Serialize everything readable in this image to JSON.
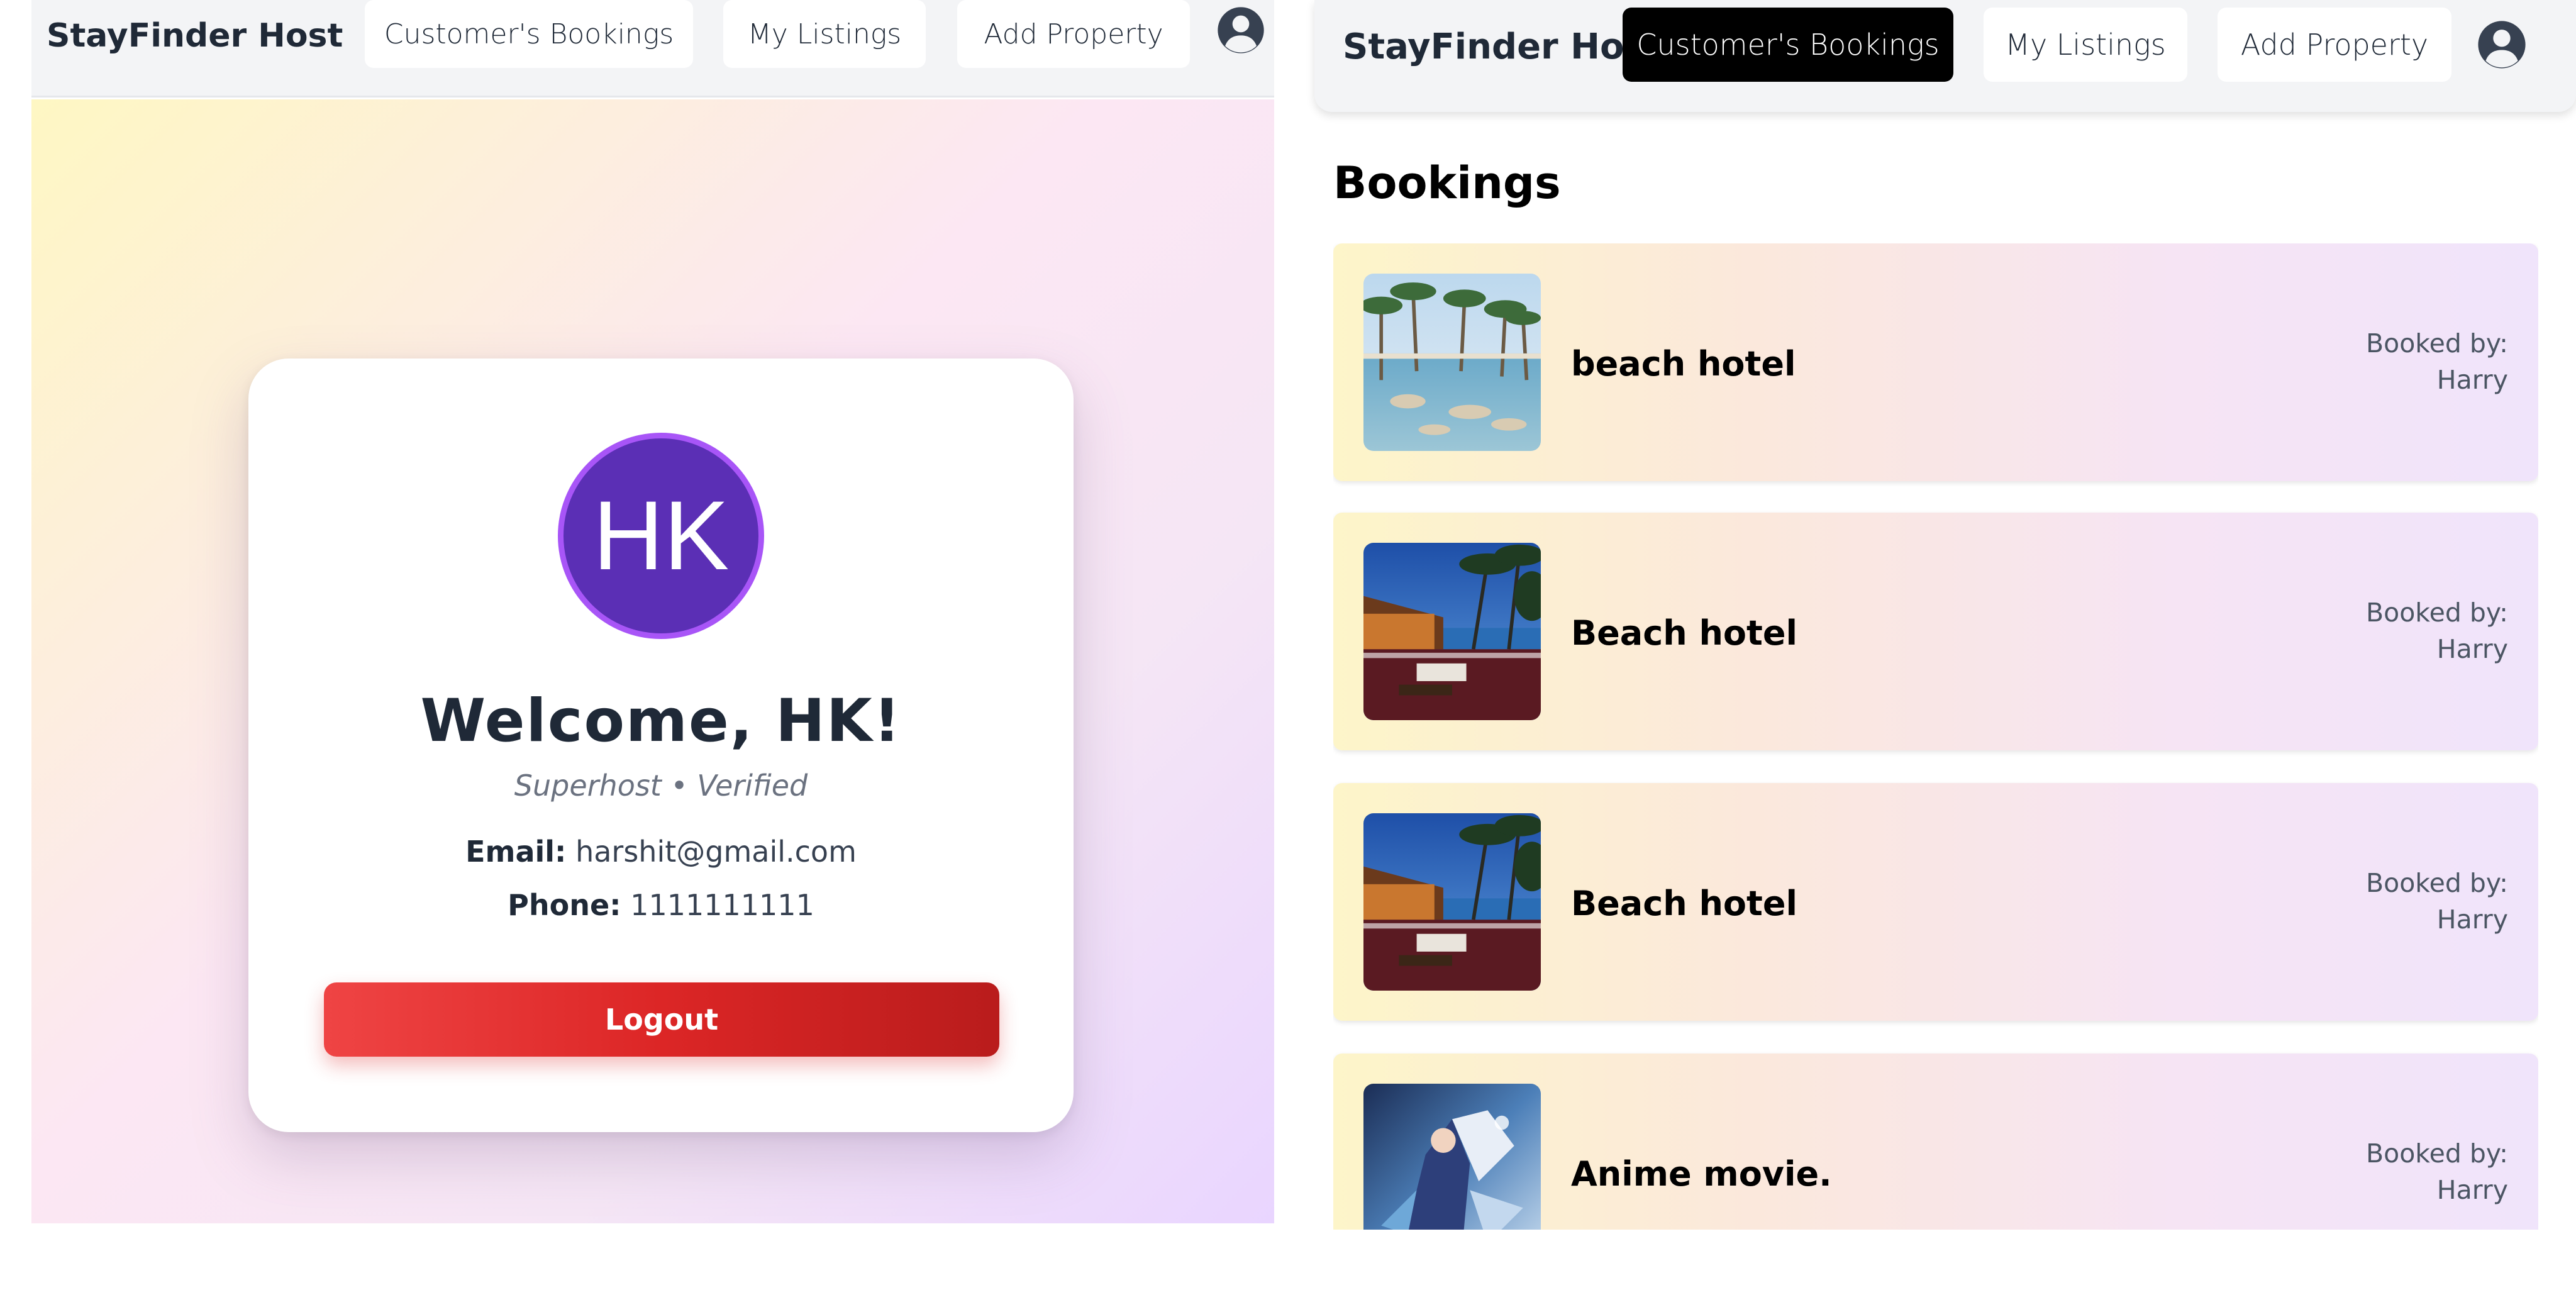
{
  "left": {
    "nav": {
      "brand": "StayFinder Host",
      "items": [
        {
          "label": "Customer's Bookings"
        },
        {
          "label": "My Listings"
        },
        {
          "label": "Add Property"
        }
      ],
      "user_icon": "user-circle-icon"
    },
    "profile": {
      "avatar_initials": "HK",
      "welcome": "Welcome, HK!",
      "subtitle": "Superhost • Verified",
      "email_label": "Email:",
      "email": "harshit@gmail.com",
      "phone_label": "Phone:",
      "phone": "1111111111",
      "logout_label": "Logout"
    }
  },
  "right": {
    "nav": {
      "brand": "StayFinder Host",
      "items": [
        {
          "label": "Customer's Bookings",
          "active": true
        },
        {
          "label": "My Listings",
          "active": false
        },
        {
          "label": "Add Property",
          "active": false
        }
      ],
      "user_icon": "user-circle-icon"
    },
    "bookings": {
      "title": "Bookings",
      "items": [
        {
          "name": "beach hotel",
          "booked_by_label": "Booked by:",
          "booked_by": "Harry",
          "image": "resort-pool-photo"
        },
        {
          "name": "Beach hotel",
          "booked_by_label": "Booked by:",
          "booked_by": "Harry",
          "image": "beach-terrace-photo"
        },
        {
          "name": "Beach hotel",
          "booked_by_label": "Booked by:",
          "booked_by": "Harry",
          "image": "beach-terrace-photo"
        },
        {
          "name": "Anime movie.",
          "booked_by_label": "Booked by:",
          "booked_by": "Harry",
          "image": "anime-poster-photo"
        }
      ]
    }
  },
  "colors": {
    "accent_active": "#000000",
    "logout": "#dc2626",
    "avatar": "#5b2fb5",
    "avatar_ring": "#a855f7"
  }
}
